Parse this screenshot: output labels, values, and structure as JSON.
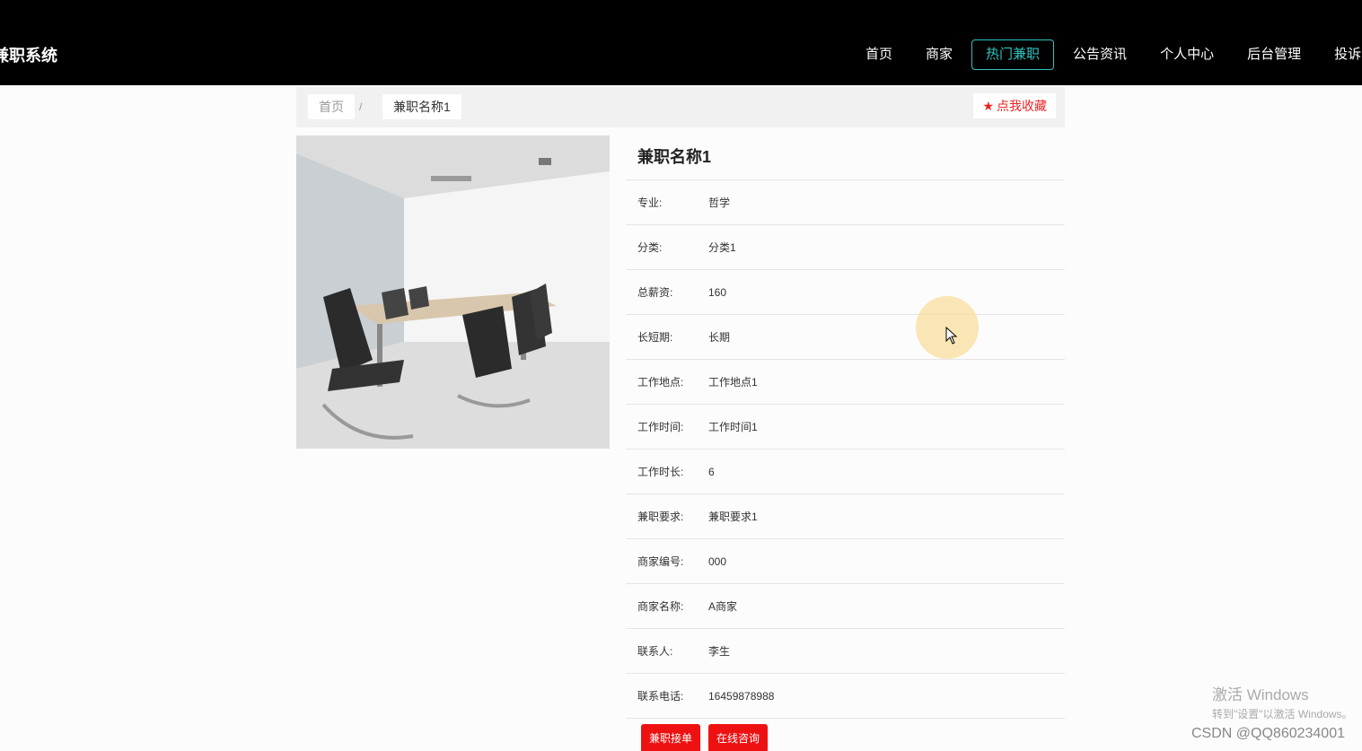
{
  "header": {
    "brand": "兼职系统",
    "nav": [
      "首页",
      "商家",
      "热门兼职",
      "公告资讯",
      "个人中心",
      "后台管理",
      "投诉"
    ],
    "active_nav": "热门兼职"
  },
  "breadcrumb": {
    "home": "首页",
    "separator": "/",
    "current": "兼职名称1"
  },
  "favorite_label": "点我收藏",
  "detail": {
    "title": "兼职名称1",
    "fields": [
      {
        "label": "专业:",
        "value": "哲学"
      },
      {
        "label": "分类:",
        "value": "分类1"
      },
      {
        "label": "总薪资:",
        "value": "160"
      },
      {
        "label": "长短期:",
        "value": "长期"
      },
      {
        "label": "工作地点:",
        "value": "工作地点1"
      },
      {
        "label": "工作时间:",
        "value": "工作时间1"
      },
      {
        "label": "工作时长:",
        "value": "6"
      },
      {
        "label": "兼职要求:",
        "value": "兼职要求1"
      },
      {
        "label": "商家编号:",
        "value": "000"
      },
      {
        "label": "商家名称:",
        "value": "A商家"
      },
      {
        "label": "联系人:",
        "value": "李生"
      },
      {
        "label": "联系电话:",
        "value": "16459878988"
      }
    ],
    "actions": [
      "兼职接单",
      "在线咨询"
    ]
  },
  "overlay": {
    "activation_title": "激活 Windows",
    "activation_sub": "转到\"设置\"以激活 Windows。",
    "csdn": "CSDN @QQ860234001"
  },
  "colors": {
    "accent": "#2ec4c0",
    "danger": "#ee1111",
    "header_bg": "#000000"
  }
}
